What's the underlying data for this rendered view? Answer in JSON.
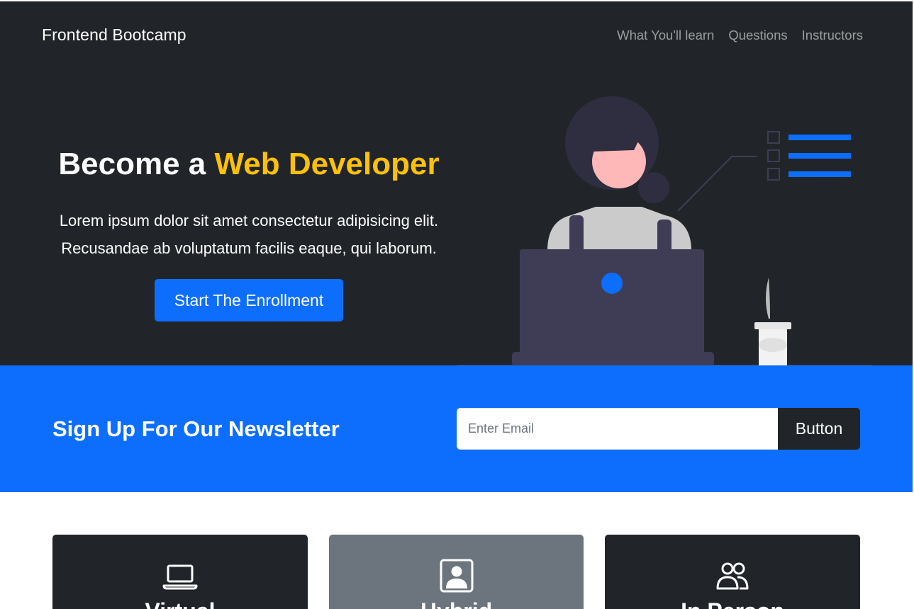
{
  "navbar": {
    "brand": "Frontend Bootcamp",
    "links": [
      "What You'll learn",
      "Questions",
      "Instructors"
    ]
  },
  "hero": {
    "title_part1": "Become a",
    "title_accent": "Web Developer",
    "text_line1": "Lorem ipsum dolor sit amet consectetur adipisicing elit.",
    "text_line2": "Recusandae ab voluptatum facilis eaque, qui laborum.",
    "button_label": "Start The Enrollment",
    "illustration": "woman-at-laptop-illustration"
  },
  "newsletter": {
    "title": "Sign Up For Our Newsletter",
    "input_placeholder": "Enter Email",
    "input_value": "",
    "button_label": "Button"
  },
  "cards": [
    {
      "icon": "laptop-icon",
      "title": "Virtual"
    },
    {
      "icon": "person-square-icon",
      "title": "Hybrid"
    },
    {
      "icon": "people-icon",
      "title": "In Person"
    }
  ],
  "colors": {
    "dark": "#212529",
    "primary": "#0d6efd",
    "accent": "#ffc107",
    "secondary": "#6c757d"
  }
}
